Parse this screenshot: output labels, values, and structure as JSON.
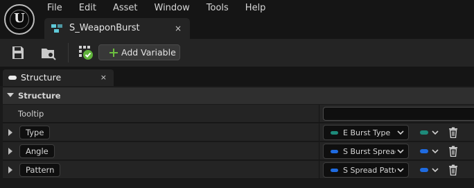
{
  "menubar": {
    "items": [
      "File",
      "Edit",
      "Asset",
      "Window",
      "Tools",
      "Help"
    ]
  },
  "document_tab": {
    "title": "S_WeaponBurst",
    "close": "×"
  },
  "toolbar": {
    "add_variable_label": "Add Variable",
    "icons": [
      "save-icon",
      "browse-asset-icon",
      "compile-status-icon"
    ]
  },
  "panel_tab": {
    "label": "Structure",
    "close": "×"
  },
  "structure": {
    "category": "Structure",
    "tooltip_label": "Tooltip",
    "tooltip_value": "",
    "variables": [
      {
        "name": "Type",
        "type": "E Burst Type",
        "type_color": "#1d8a7a"
      },
      {
        "name": "Angle",
        "type": "S Burst Spread",
        "type_color": "#1f6be0"
      },
      {
        "name": "Pattern",
        "type": "S Spread Pattern",
        "type_color": "#1f6be0"
      }
    ]
  },
  "colors": {
    "background": "#151515",
    "panel": "#242424",
    "accent_cyan": "#5fc9d8",
    "add_green": "#6cbf3f",
    "enum_teal": "#1d8a7a",
    "struct_blue": "#1f6be0"
  }
}
